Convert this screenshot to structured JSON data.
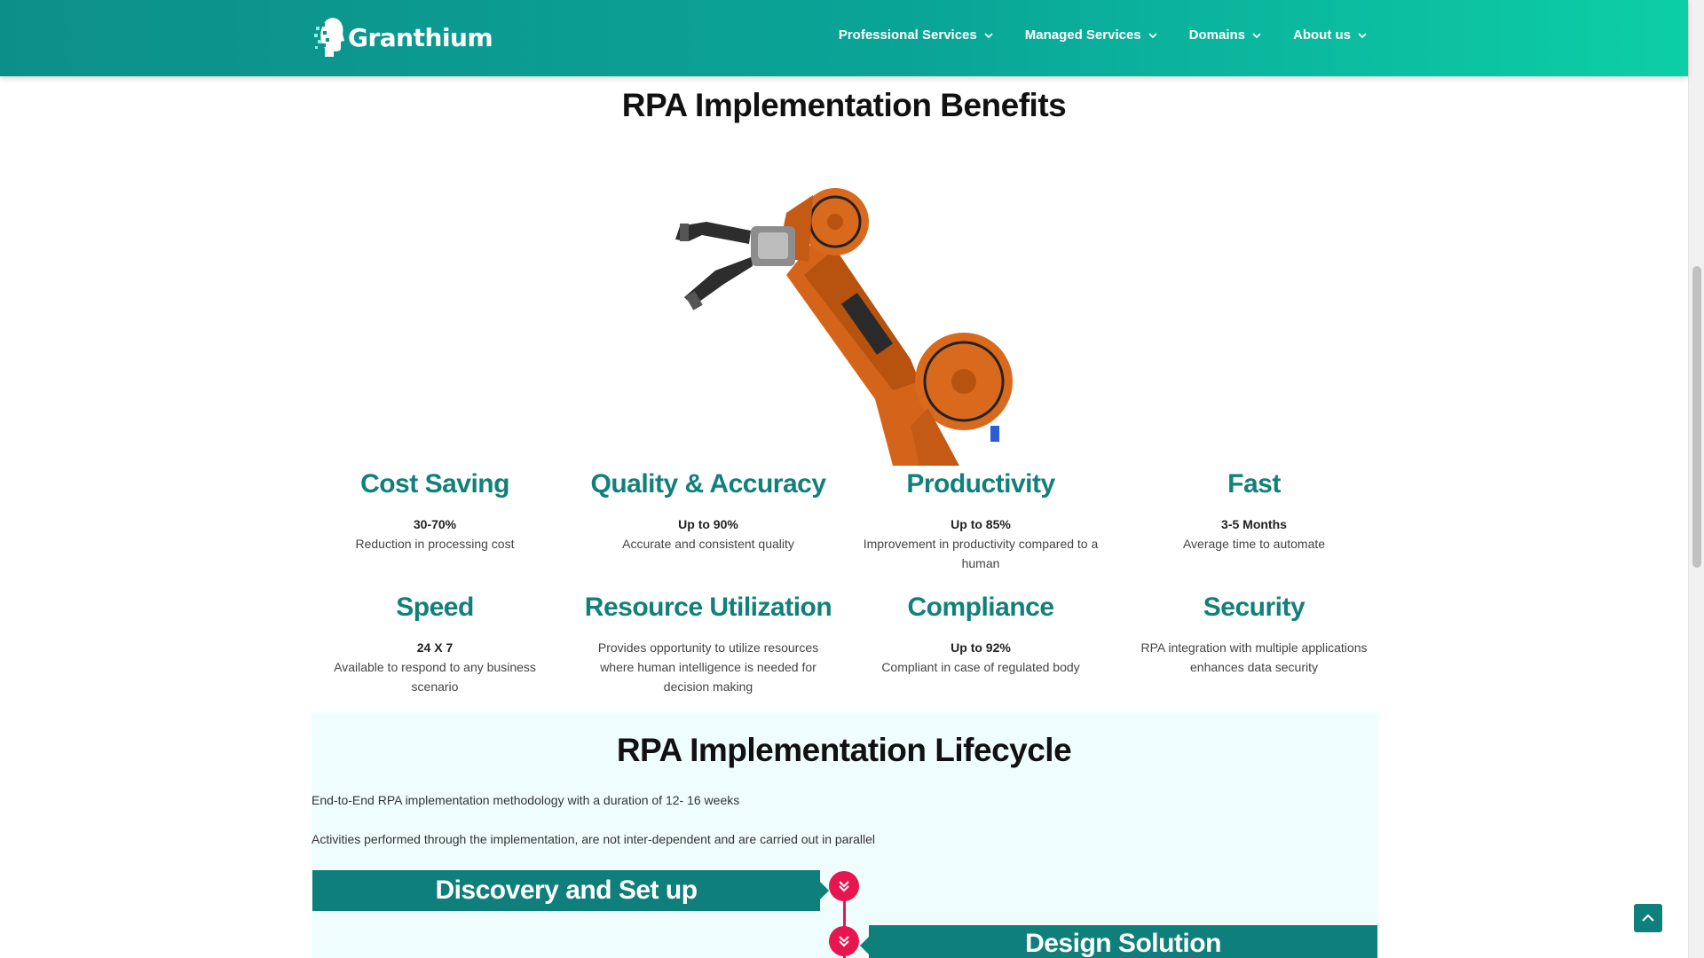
{
  "header": {
    "brand": "Granthium",
    "nav": [
      {
        "label": "Professional Services"
      },
      {
        "label": "Managed Services"
      },
      {
        "label": "Domains"
      },
      {
        "label": "About us"
      }
    ]
  },
  "benefits": {
    "title": "RPA Implementation Benefits",
    "items": [
      {
        "title": "Cost Saving",
        "stat": "30-70%",
        "desc": "Reduction in processing cost"
      },
      {
        "title": "Quality & Accuracy",
        "stat": "Up to 90%",
        "desc": "Accurate and consistent quality"
      },
      {
        "title": "Productivity",
        "stat": "Up to 85%",
        "desc": "Improvement in productivity compared to a human"
      },
      {
        "title": "Fast",
        "stat": "3-5 Months",
        "desc": "Average time to automate"
      },
      {
        "title": "Speed",
        "stat": "24 X 7",
        "desc": "Available to respond to any business scenario"
      },
      {
        "title": "Resource Utilization",
        "desc": "Provides opportunity to utilize resources where human intelligence is needed for decision making"
      },
      {
        "title": "Compliance",
        "stat": "Up to 92%",
        "desc": "Compliant in case of regulated body"
      },
      {
        "title": "Security",
        "desc": "RPA integration with multiple applications enhances data security"
      }
    ]
  },
  "lifecycle": {
    "title": "RPA Implementation Lifecycle",
    "intro_1": "End-to-End RPA implementation methodology with a duration of 12- 16 weeks",
    "intro_2": "Activities performed through the implementation, are not inter-dependent and are carried out in parallel",
    "phases": [
      {
        "label": "Discovery and Set up"
      },
      {
        "label": "Design Solution"
      }
    ]
  },
  "colors": {
    "brand_teal": "#0e7f7b",
    "accent_pink": "#e8164f",
    "header_gradient_end": "#0ccfa6"
  },
  "icons": {
    "logo": "head-pixel-icon",
    "nav_dropdown": "chevron-down-icon",
    "timeline_node": "double-chevron-down-icon",
    "back_to_top": "chevron-up-icon"
  }
}
